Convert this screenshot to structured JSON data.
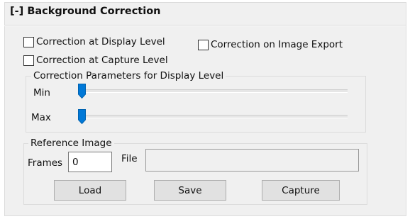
{
  "section": {
    "title": "[-] Background Correction"
  },
  "checkboxes": {
    "display_level": {
      "label": "Correction at Display Level",
      "checked": false
    },
    "capture_level": {
      "label": "Correction at Capture Level",
      "checked": false
    },
    "image_export": {
      "label": "Correction on Image Export",
      "checked": false
    }
  },
  "display_params": {
    "legend": "Correction Parameters for Display Level",
    "min": {
      "label": "Min",
      "value_fraction": 0.0
    },
    "max": {
      "label": "Max",
      "value_fraction": 0.0
    }
  },
  "reference_image": {
    "legend": "Reference Image",
    "frames_label": "Frames",
    "frames_value": "0",
    "file_label": "File",
    "file_value": "",
    "buttons": {
      "load": "Load",
      "save": "Save",
      "capture": "Capture"
    }
  },
  "colors": {
    "panel_bg": "#f0f0f0",
    "slider_thumb": "#0078d7",
    "button_bg": "#e1e1e1"
  }
}
